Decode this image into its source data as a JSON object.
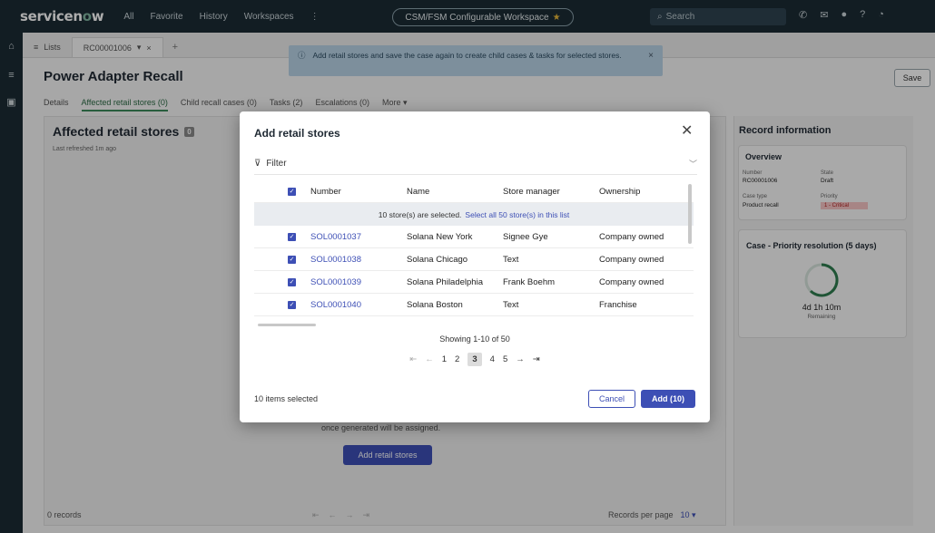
{
  "topbar": {
    "logo_pre": "servicen",
    "logo_o": "o",
    "logo_post": "w",
    "nav": [
      "All",
      "Favorite",
      "History",
      "Workspaces",
      "⋮"
    ],
    "workspace": "CSM/FSM Configurable Workspace",
    "search_placeholder": "Search"
  },
  "tabs": {
    "lists": "Lists",
    "record": "RC00001006",
    "add": "+"
  },
  "toast": {
    "message": "Add retail stores and save the case again to create child cases & tasks for selected stores."
  },
  "record": {
    "title": "Power Adapter Recall",
    "save": "Save",
    "subtabs": [
      "Details",
      "Affected retail stores (0)",
      "Child recall cases (0)",
      "Tasks (2)",
      "Escalations (0)",
      "More ▾"
    ]
  },
  "affected": {
    "title": "Affected retail stores",
    "count": "0",
    "refreshed": "Last refreshed 1m ago",
    "empty_text": "once generated will be assigned.",
    "add_button": "Add retail stores",
    "records": "0 records",
    "per_page_label": "Records per page",
    "per_page_value": "10 ▾"
  },
  "record_info": {
    "title": "Record information",
    "overview": "Overview",
    "number_label": "Number",
    "number_value": "RC00001006",
    "state_label": "State",
    "state_value": "Draft",
    "case_type_label": "Case type",
    "case_type_value": "Product recall",
    "priority_label": "Priority",
    "priority_value": "1 - Critical",
    "sla_title": "Case - Priority resolution (5 days)",
    "sla_time": "4d 1h 10m",
    "sla_remaining": "Remaining"
  },
  "modal": {
    "title": "Add retail stores",
    "filter": "Filter",
    "columns": [
      "Number",
      "Name",
      "Store manager",
      "Ownership"
    ],
    "selected_msg": "10 store(s) are selected.",
    "select_all": "Select all 50 store(s) in this list",
    "rows": [
      {
        "number": "SOL0001037",
        "name": "Solana New York",
        "manager": "Signee Gye",
        "ownership": "Company owned"
      },
      {
        "number": "SOL0001038",
        "name": "Solana Chicago",
        "manager": "Text",
        "ownership": "Company owned"
      },
      {
        "number": "SOL0001039",
        "name": "Solana Philadelphia",
        "manager": "Frank Boehm",
        "ownership": "Company owned"
      },
      {
        "number": "SOL0001040",
        "name": "Solana Boston",
        "manager": "Text",
        "ownership": "Franchise"
      }
    ],
    "showing": "Showing 1-10 of 50",
    "pages": [
      "1",
      "2",
      "3",
      "4",
      "5"
    ],
    "current_page": "3",
    "items_selected": "10 items selected",
    "cancel": "Cancel",
    "add": "Add (10)"
  },
  "colors": {
    "brand_dark": "#1b2b34",
    "primary": "#3d4fb5",
    "accent_green": "#3b8a5a"
  }
}
